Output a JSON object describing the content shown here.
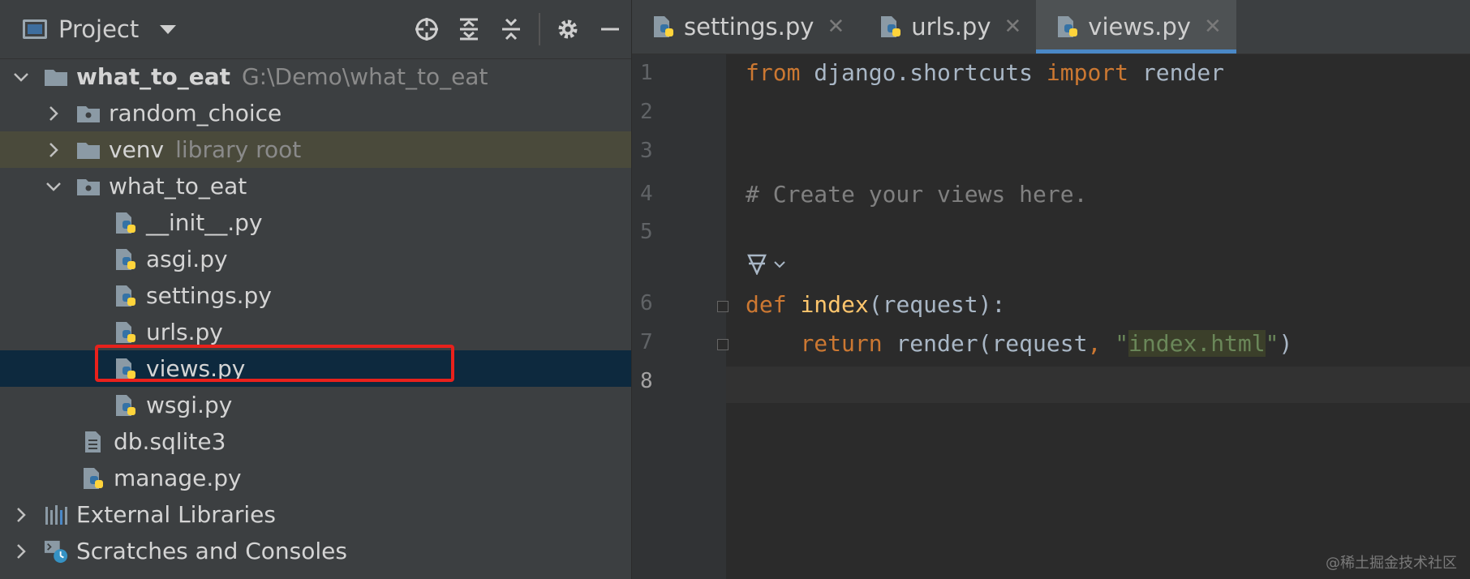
{
  "project_pane": {
    "title": "Project",
    "tree": [
      {
        "label": "what_to_eat",
        "extra": "G:\\Demo\\what_to_eat"
      },
      {
        "label": "random_choice"
      },
      {
        "label": "venv",
        "extra": "library root"
      },
      {
        "label": "what_to_eat"
      },
      {
        "label": "__init__.py"
      },
      {
        "label": "asgi.py"
      },
      {
        "label": "settings.py"
      },
      {
        "label": "urls.py"
      },
      {
        "label": "views.py"
      },
      {
        "label": "wsgi.py"
      },
      {
        "label": "db.sqlite3"
      },
      {
        "label": "manage.py"
      },
      {
        "label": "External Libraries"
      },
      {
        "label": "Scratches and Consoles"
      }
    ]
  },
  "tabs": [
    {
      "label": "settings.py"
    },
    {
      "label": "urls.py"
    },
    {
      "label": "views.py",
      "active": true
    }
  ],
  "editor": {
    "line_numbers": [
      "1",
      "2",
      "3",
      "4",
      "5",
      "6",
      "7",
      "8"
    ],
    "code": {
      "l1_from": "from",
      "l1_mod": " django.shortcuts ",
      "l1_import": "import",
      "l1_name": " render",
      "l4_comment": "# Create your views here.",
      "l6_def": "def",
      "l6_fn": "index",
      "l6_rest": "(request):",
      "l7_return": "return",
      "l7_call": " render(request",
      "l7_comma": ", ",
      "l7_q1": "\"",
      "l7_str": "index.html",
      "l7_q2": "\"",
      "l7_close": ")"
    }
  },
  "watermark": "@稀土掘金技术社区",
  "colors": {
    "keyword": "#cc7832",
    "comment": "#808080",
    "function": "#ffc66d",
    "string": "#6a8759",
    "selection_box": "#e8211c",
    "active_tab_underline": "#4a88c7"
  }
}
